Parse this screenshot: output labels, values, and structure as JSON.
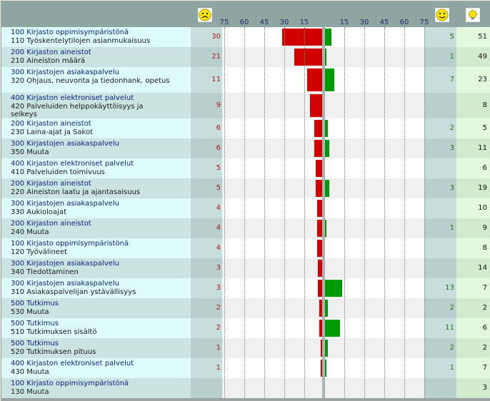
{
  "header": {
    "neg_ticks": [
      "75",
      "60",
      "45",
      "30",
      "15"
    ],
    "pos_ticks": [
      "15",
      "30",
      "45",
      "60",
      "75"
    ],
    "icons": {
      "sad": "sad-face-icon",
      "happy": "happy-face-icon",
      "idea": "lightbulb-icon"
    }
  },
  "colors": {
    "negative": "#d00000",
    "positive": "#009b00"
  },
  "chart_data": {
    "type": "bar",
    "axis_ticks": [
      75,
      60,
      45,
      30,
      15,
      15,
      30,
      45,
      60,
      75
    ],
    "rows": [
      {
        "category": "100 Kirjasto oppimisympäristönä",
        "sub": "110 Työskentelytilojen asianmukaisuus",
        "neg": "30",
        "pos": "5",
        "total": "51"
      },
      {
        "category": "200 Kirjaston aineistot",
        "sub": "210 Aineiston määrä",
        "neg": "21",
        "pos": "1",
        "total": "49"
      },
      {
        "category": "300 Kirjastojen asiakaspalvelu",
        "sub": "320 Ohjaus, neuvonta ja tiedonhank. opetus",
        "neg": "11",
        "pos": "7",
        "total": "23"
      },
      {
        "category": "400 Kirjaston elektroniset palvelut",
        "sub": "420 Palveluiden helppokäyttöisyys ja selkeys",
        "neg": "9",
        "pos": "",
        "total": "8"
      },
      {
        "category": "200 Kirjaston aineistot",
        "sub": "230 Laina-ajat ja Sakot",
        "neg": "6",
        "pos": "2",
        "total": "5"
      },
      {
        "category": "300 Kirjastojen asiakaspalvelu",
        "sub": "350 Muuta",
        "neg": "6",
        "pos": "3",
        "total": "11"
      },
      {
        "category": "400 Kirjaston elektroniset palvelut",
        "sub": "410 Palveluiden toimivuus",
        "neg": "5",
        "pos": "",
        "total": "6"
      },
      {
        "category": "200 Kirjaston aineistot",
        "sub": "220 Aineiston laatu ja ajantasaisuus",
        "neg": "5",
        "pos": "3",
        "total": "19"
      },
      {
        "category": "300 Kirjastojen asiakaspalvelu",
        "sub": "330 Aukioloajat",
        "neg": "4",
        "pos": "",
        "total": "10"
      },
      {
        "category": "200 Kirjaston aineistot",
        "sub": "240 Muuta",
        "neg": "4",
        "pos": "1",
        "total": "9"
      },
      {
        "category": "100 Kirjasto oppimisympäristönä",
        "sub": "120 Työvälineet",
        "neg": "4",
        "pos": "",
        "total": "8"
      },
      {
        "category": "300 Kirjastojen asiakaspalvelu",
        "sub": "340 Tiedottaminen",
        "neg": "3",
        "pos": "",
        "total": "14"
      },
      {
        "category": "300 Kirjastojen asiakaspalvelu",
        "sub": "310 Asiakaspalvelijan ystävällisyys",
        "neg": "3",
        "pos": "13",
        "total": "7"
      },
      {
        "category": "500 Tutkimus",
        "sub": "530 Muuta",
        "neg": "2",
        "pos": "2",
        "total": "2"
      },
      {
        "category": "500 Tutkimus",
        "sub": "510 Tutkimuksen sisältö",
        "neg": "2",
        "pos": "11",
        "total": "6"
      },
      {
        "category": "500 Tutkimus",
        "sub": "520 Tutkimuksen pituus",
        "neg": "1",
        "pos": "2",
        "total": "2"
      },
      {
        "category": "400 Kirjaston elektroniset palvelut",
        "sub": "430 Muuta",
        "neg": "1",
        "pos": "1",
        "total": "7"
      },
      {
        "category": "100 Kirjasto oppimisympäristönä",
        "sub": "130 Muuta",
        "neg": "",
        "pos": "",
        "total": "3"
      }
    ]
  }
}
